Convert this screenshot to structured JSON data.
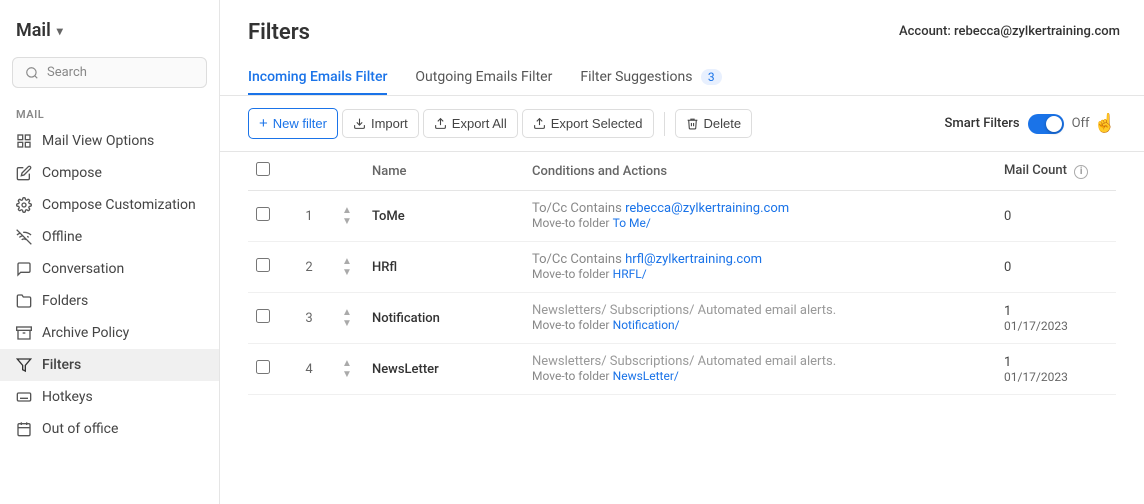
{
  "app": {
    "title": "Mail",
    "chevron": "▾"
  },
  "account": {
    "label": "Account:",
    "email": "rebecca@zylkertraining.com"
  },
  "sidebar": {
    "search_placeholder": "Search",
    "section_label": "MAIL",
    "items": [
      {
        "id": "mail-view-options",
        "label": "Mail View Options",
        "icon": "view"
      },
      {
        "id": "compose",
        "label": "Compose",
        "icon": "compose"
      },
      {
        "id": "compose-customization",
        "label": "Compose Customization",
        "icon": "customization"
      },
      {
        "id": "offline",
        "label": "Offline",
        "icon": "offline"
      },
      {
        "id": "conversation",
        "label": "Conversation",
        "icon": "conversation"
      },
      {
        "id": "folders",
        "label": "Folders",
        "icon": "folders"
      },
      {
        "id": "archive-policy",
        "label": "Archive Policy",
        "icon": "archive"
      },
      {
        "id": "filters",
        "label": "Filters",
        "icon": "filters",
        "active": true
      },
      {
        "id": "hotkeys",
        "label": "Hotkeys",
        "icon": "hotkeys"
      },
      {
        "id": "out-of-office",
        "label": "Out of office",
        "icon": "out-of-office"
      }
    ]
  },
  "page": {
    "title": "Filters"
  },
  "tabs": [
    {
      "id": "incoming",
      "label": "Incoming Emails Filter",
      "active": true,
      "badge": null
    },
    {
      "id": "outgoing",
      "label": "Outgoing Emails Filter",
      "active": false,
      "badge": null
    },
    {
      "id": "suggestions",
      "label": "Filter Suggestions",
      "active": false,
      "badge": "3"
    }
  ],
  "toolbar": {
    "new_filter": "New filter",
    "import": "Import",
    "export_all": "Export All",
    "export_selected": "Export Selected",
    "delete": "Delete",
    "smart_filters": "Smart Filters",
    "off": "Off"
  },
  "table": {
    "headers": [
      "",
      "",
      "",
      "Name",
      "Conditions and Actions",
      "Mail Count"
    ],
    "rows": [
      {
        "num": "1",
        "name": "ToMe",
        "conditions": "To/Cc Contains",
        "email": "rebecca@zylkertraining.com",
        "move_to_label": "Move-to folder",
        "folder": "To Me/",
        "count": "0",
        "date": ""
      },
      {
        "num": "2",
        "name": "HRfl",
        "conditions": "To/Cc Contains",
        "email": "hrfl@zylkertraining.com",
        "move_to_label": "Move-to folder",
        "folder": "HRFL/",
        "count": "0",
        "date": ""
      },
      {
        "num": "3",
        "name": "Notification",
        "conditions": "Newsletters/ Subscriptions/ Automated email alerts.",
        "email": "",
        "move_to_label": "Move-to folder",
        "folder": "Notification/",
        "count": "1",
        "date": "01/17/2023"
      },
      {
        "num": "4",
        "name": "NewsLetter",
        "conditions": "Newsletters/ Subscriptions/ Automated email alerts.",
        "email": "",
        "move_to_label": "Move-to folder",
        "folder": "NewsLetter/",
        "count": "1",
        "date": "01/17/2023"
      }
    ]
  }
}
